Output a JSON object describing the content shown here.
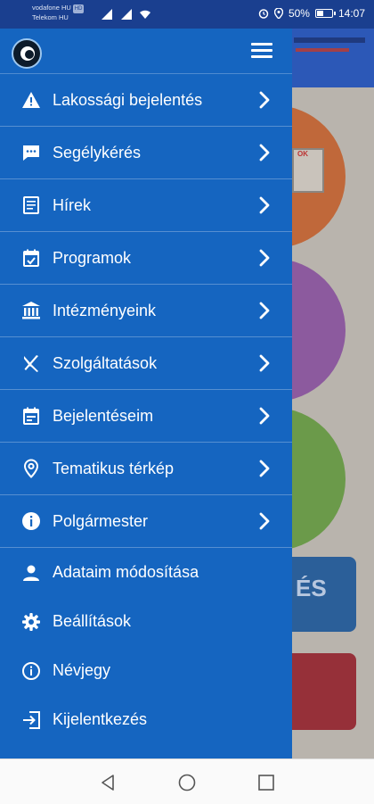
{
  "status_bar": {
    "carrier1": "vodafone HU",
    "carrier1_badge": "HD",
    "carrier2": "Telekom HU",
    "battery_percent": "50%",
    "battery_level": 0.5,
    "time": "14:07",
    "icons": [
      "signal-icon",
      "wifi-icon",
      "alarm-icon",
      "location-icon",
      "battery-icon"
    ]
  },
  "drawer": {
    "menu_icon": "hamburger-icon",
    "items": [
      {
        "label": "Lakossági bejelentés",
        "icon": "warning-icon",
        "has_chevron": true
      },
      {
        "label": "Segélykérés",
        "icon": "chat-bubble-icon",
        "has_chevron": true
      },
      {
        "label": "Hírek",
        "icon": "news-icon",
        "has_chevron": true
      },
      {
        "label": "Programok",
        "icon": "calendar-event-icon",
        "has_chevron": true
      },
      {
        "label": "Intézményeink",
        "icon": "institution-icon",
        "has_chevron": true
      },
      {
        "label": "Szolgáltatások",
        "icon": "cutlery-icon",
        "has_chevron": true
      },
      {
        "label": "Bejelentéseim",
        "icon": "calendar-icon",
        "has_chevron": true
      },
      {
        "label": "Tematikus térkép",
        "icon": "map-pin-icon",
        "has_chevron": true
      },
      {
        "label": "Polgármester",
        "icon": "info-icon",
        "has_chevron": true
      },
      {
        "label": "Adataim módosítása",
        "icon": "person-icon",
        "has_chevron": false
      },
      {
        "label": "Beállítások",
        "icon": "gear-icon",
        "has_chevron": false
      },
      {
        "label": "Névjegy",
        "icon": "info-outline-icon",
        "has_chevron": false
      },
      {
        "label": "Kijelentkezés",
        "icon": "logout-icon",
        "has_chevron": false
      }
    ]
  },
  "background": {
    "card_text": "ÉS"
  },
  "colors": {
    "drawer": "#1565c0",
    "status_bar": "#1a3f8f",
    "nav_bar": "#fafafa"
  }
}
